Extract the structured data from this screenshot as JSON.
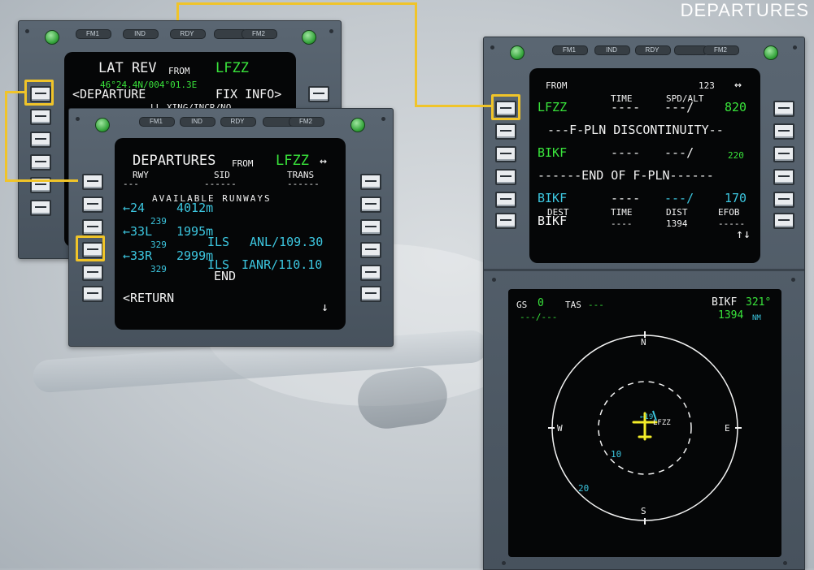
{
  "page_title": "DEPARTURES",
  "annunciators": [
    "FM1",
    "IND",
    "RDY",
    "FM2"
  ],
  "mcdu_latrev": {
    "title": "LAT REV",
    "from_word": "FROM",
    "airport": "LFZZ",
    "coords": "46°24.4N/004°01.3E",
    "departure": "<DEPARTURE",
    "fix_info": "FIX INFO>",
    "ll_xing": "LL XING/INCR/NO"
  },
  "mcdu_departures": {
    "title": "DEPARTURES",
    "from_word": "FROM",
    "airport": "LFZZ",
    "scroll": "↔",
    "col_rwy": "RWY",
    "col_sid": "SID",
    "col_trans": "TRANS",
    "dashes_rwy": "---",
    "dashes_sid": "------",
    "dashes_trans": "------",
    "available": "AVAILABLE RUNWAYS",
    "rows": [
      {
        "rwy": "←24",
        "len": "4012m",
        "crs": "239",
        "ils": "",
        "freq": ""
      },
      {
        "rwy": "←33L",
        "len": "1995m",
        "crs": "329",
        "ils": "ILS",
        "freq": "ANL/109.30"
      },
      {
        "rwy": "←33R",
        "len": "2999m",
        "crs": "329",
        "ils": "ILS",
        "freq": "IANR/110.10"
      }
    ],
    "end": "END",
    "return": "<RETURN",
    "down_arrow": "↓"
  },
  "mcdu_fpln": {
    "from_word": "FROM",
    "page": "123",
    "scroll": "↔",
    "time_hdr": "TIME",
    "spdalt_hdr": "SPD/ALT",
    "wp1": "LFZZ",
    "wp1_time": "----",
    "wp1_spd": "---/",
    "wp1_alt": "820",
    "discontinuity": "---F-PLN DISCONTINUITY--",
    "wp2": "BIKF",
    "wp2_time": "----",
    "wp2_spd": "---/",
    "wp2_alt": "220",
    "end_fpln": "------END OF F-PLN------",
    "wp3": "BIKF",
    "wp3_time": "----",
    "wp3_spd": "---/",
    "wp3_alt": "170",
    "dest_hdr": "DEST",
    "dest_time_hdr": "TIME",
    "dist_hdr": "DIST",
    "efob_hdr": "EFOB",
    "dest": "BIKF",
    "dest_time": "----",
    "dist": "1394",
    "efob": "-----",
    "updown": "↑↓"
  },
  "nd": {
    "gs_label": "GS",
    "gs": "0",
    "tas_label": "TAS",
    "tas": "---",
    "wind": "---/---",
    "wpt": "BIKF",
    "brg": "321°",
    "dist": "1394",
    "dist_unit": "NM",
    "north": "N",
    "south": "S",
    "east": "E",
    "west": "W",
    "rwy_label": "←19",
    "apt_label": "LFZZ",
    "range10": "10",
    "range20": "20"
  }
}
